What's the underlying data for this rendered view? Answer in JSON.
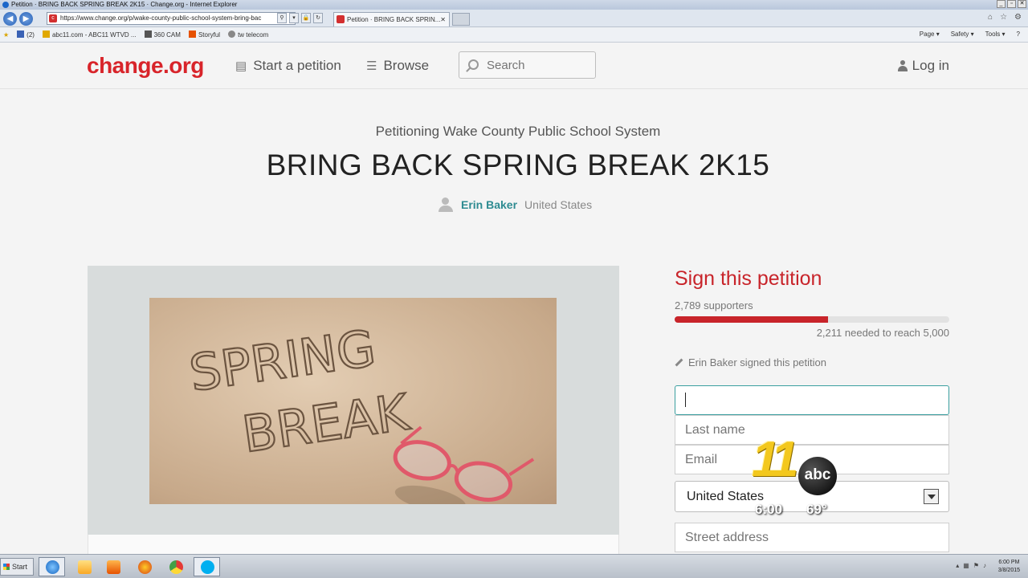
{
  "browser": {
    "window_title": "Petition · BRING BACK SPRING BREAK 2K15 · Change.org - Internet Explorer",
    "url": "https://www.change.org/p/wake-county-public-school-system-bring-bac",
    "tab_title": "Petition · BRING BACK SPRIN...",
    "favorites": [
      "(2)",
      "abc11.com - ABC11 WTVD ...",
      "360 CAM",
      "Storyful",
      "tw telecom"
    ],
    "commands": [
      "Page ▾",
      "Safety ▾",
      "Tools ▾"
    ]
  },
  "header": {
    "logo": "change.org",
    "start_petition": "Start a petition",
    "browse": "Browse",
    "search_placeholder": "Search",
    "login": "Log in"
  },
  "petition": {
    "petitioning": "Petitioning Wake County Public School System",
    "title": "BRING BACK SPRING BREAK 2K15",
    "author_name": "Erin Baker",
    "author_location": "United States",
    "image_text_line1": "SPRING",
    "image_text_line2": "BREAK"
  },
  "sign": {
    "heading": "Sign this petition",
    "supporters": "2,789 supporters",
    "progress_fraction": 0.5578,
    "needed": "2,211 needed to reach 5,000",
    "recent_signer": "Erin Baker signed this petition",
    "first_name_value": "",
    "last_name_placeholder": "Last name",
    "email_placeholder": "Email",
    "country_value": "United States",
    "street_placeholder": "Street address"
  },
  "watermark": {
    "channel": "11",
    "network": "abc",
    "time": "6:00",
    "temp": "69°"
  },
  "taskbar": {
    "start": "Start",
    "clock_time": "6:00 PM",
    "clock_date": "3/8/2015"
  },
  "colors": {
    "brand_red": "#d8242a",
    "accent_teal": "#2e8b91"
  }
}
